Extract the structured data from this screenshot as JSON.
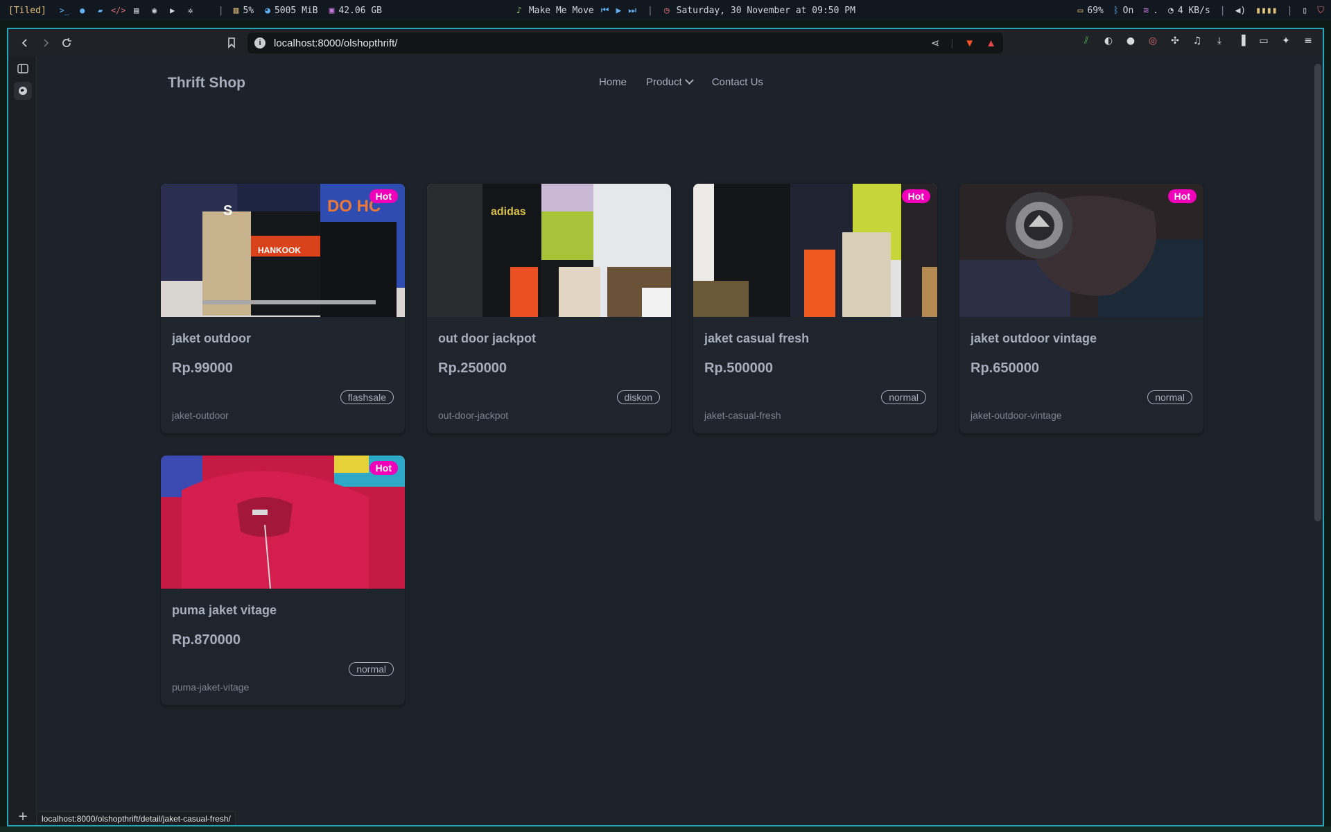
{
  "sysbar": {
    "workspace_mode": "[Tiled]",
    "cpu": "5%",
    "memory": "5005 MiB",
    "disk": "42.06 GB",
    "music_title": "Make Me Move",
    "datetime": "Saturday, 30 November at 09:50 PM",
    "battery": "69%",
    "bluetooth": "On",
    "wifi": ".",
    "netspeed": "4 KB/s"
  },
  "browser": {
    "url": "localhost:8000/olshopthrift/",
    "status_url": "localhost:8000/olshopthrift/detail/jaket-casual-fresh/"
  },
  "site": {
    "brand": "Thrift Shop",
    "nav": {
      "home": "Home",
      "product": "Product",
      "contact": "Contact Us"
    }
  },
  "products": [
    {
      "title": "jaket outdoor",
      "price": "Rp.99000",
      "tag": "flashsale",
      "slug": "jaket-outdoor",
      "badge": "Hot"
    },
    {
      "title": "out door jackpot",
      "price": "Rp.250000",
      "tag": "diskon",
      "slug": "out-door-jackpot",
      "badge": ""
    },
    {
      "title": "jaket casual fresh",
      "price": "Rp.500000",
      "tag": "normal",
      "slug": "jaket-casual-fresh",
      "badge": "Hot"
    },
    {
      "title": "jaket outdoor vintage",
      "price": "Rp.650000",
      "tag": "normal",
      "slug": "jaket-outdoor-vintage",
      "badge": "Hot"
    },
    {
      "title": "puma jaket vitage",
      "price": "Rp.870000",
      "tag": "normal",
      "slug": "puma-jaket-vitage",
      "badge": "Hot"
    }
  ],
  "colors": {
    "accent_badge": "#f000b8",
    "window_border": "#25a7b9",
    "page_bg": "#1d232a",
    "text": "#a6adbb"
  }
}
